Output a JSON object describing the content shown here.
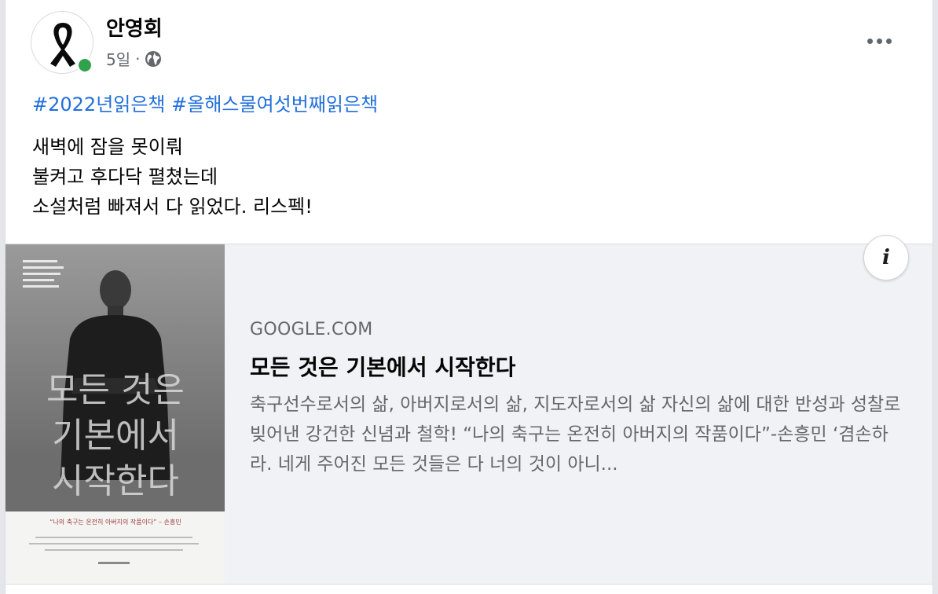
{
  "post": {
    "author": "안영회",
    "time": "5일",
    "separator": "·",
    "hashtags": [
      "#2022년읽은책",
      "#올해스물여섯번째읽은책"
    ],
    "body_lines": [
      "새벽에 잠을 못이뤄",
      "불켜고 후다닥 펼쳤는데",
      "소설처럼 빠져서 다 읽었다. 리스펙!"
    ]
  },
  "link_preview": {
    "domain": "GOOGLE.COM",
    "title": "모든 것은 기본에서 시작한다",
    "description": "축구선수로서의 삶, 아버지로서의 삶, 지도자로서의 삶 자신의 삶에 대한 반성과 성찰로 빚어낸 강건한 신념과 철학! “나의 축구는 온전히 아버지의 작품이다”-손흥민 ‘겸손하라. 네게 주어진 모든 것들은 다 너의 것이 아니...",
    "info_label": "i",
    "cover": {
      "title_lines": [
        "모든 것은",
        "기본에서",
        "시작한다"
      ],
      "quote": "“나의 축구는 온전히 아버지의 작품이다” – 손흥민"
    }
  },
  "icons": {
    "avatar": "black-ribbon-icon",
    "privacy": "globe-icon",
    "more": "more-options-icon",
    "info": "info-icon"
  },
  "colors": {
    "hashtag": "#216fdb",
    "online": "#31a24c",
    "secondary_text": "#65676b",
    "preview_bg": "#f0f2f5"
  }
}
